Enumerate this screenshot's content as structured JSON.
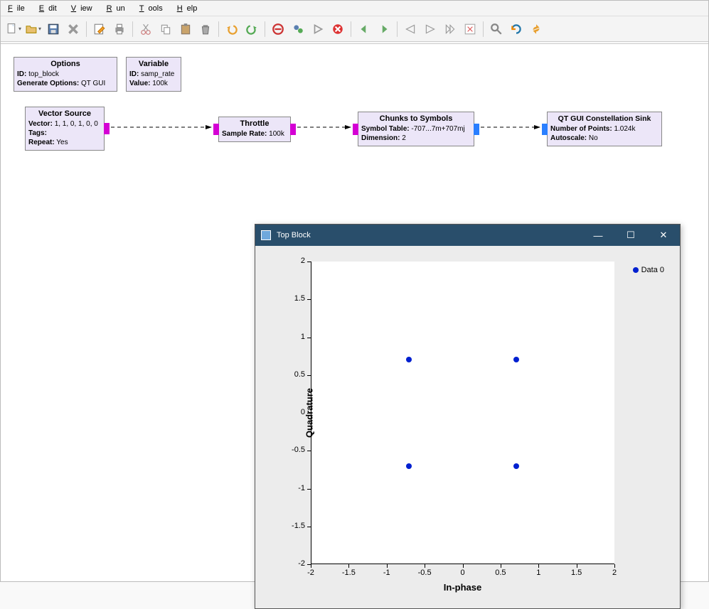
{
  "menu": {
    "file": "File",
    "edit": "Edit",
    "view": "View",
    "run": "Run",
    "tools": "Tools",
    "help": "Help"
  },
  "toolbar_icons": [
    "new",
    "open",
    "save",
    "close",
    "sep",
    "edit-props",
    "print",
    "sep",
    "cut",
    "copy",
    "paste",
    "delete",
    "sep",
    "undo",
    "redo",
    "sep",
    "stop",
    "reload",
    "run",
    "kill",
    "sep",
    "back",
    "forward",
    "sep",
    "zoom-fit",
    "zoom-sel",
    "step",
    "clear",
    "sep",
    "find",
    "refresh",
    "sync"
  ],
  "blocks": {
    "options": {
      "title": "Options",
      "rows": [
        [
          "ID:",
          "top_block"
        ],
        [
          "Generate Options:",
          "QT GUI"
        ]
      ]
    },
    "variable": {
      "title": "Variable",
      "rows": [
        [
          "ID:",
          "samp_rate"
        ],
        [
          "Value:",
          "100k"
        ]
      ]
    },
    "vector_source": {
      "title": "Vector Source",
      "rows": [
        [
          "Vector:",
          "1, 1, 0, 1, 0, 0"
        ],
        [
          "Tags:",
          ""
        ],
        [
          "Repeat:",
          "Yes"
        ]
      ]
    },
    "throttle": {
      "title": "Throttle",
      "rows": [
        [
          "Sample Rate:",
          "100k"
        ]
      ]
    },
    "chunks": {
      "title": "Chunks to Symbols",
      "rows": [
        [
          "Symbol Table:",
          "-707...7m+707mj"
        ],
        [
          "Dimension:",
          "2"
        ]
      ]
    },
    "sink": {
      "title": "QT GUI Constellation Sink",
      "rows": [
        [
          "Number of Points:",
          "1.024k"
        ],
        [
          "Autoscale:",
          "No"
        ]
      ]
    }
  },
  "plot_window": {
    "title": "Top Block"
  },
  "chart_data": {
    "type": "scatter",
    "title": "",
    "xlabel": "In-phase",
    "ylabel": "Quadrature",
    "xlim": [
      -2,
      2
    ],
    "ylim": [
      -2,
      2
    ],
    "xticks": [
      -2,
      -1.5,
      -1,
      -0.5,
      0,
      0.5,
      1,
      1.5,
      2
    ],
    "yticks": [
      -2,
      -1.5,
      -1,
      -0.5,
      0,
      0.5,
      1,
      1.5,
      2
    ],
    "series": [
      {
        "name": "Data 0",
        "points": [
          [
            -0.707,
            0.707
          ],
          [
            0.707,
            0.707
          ],
          [
            -0.707,
            -0.707
          ],
          [
            0.707,
            -0.707
          ]
        ]
      }
    ]
  }
}
